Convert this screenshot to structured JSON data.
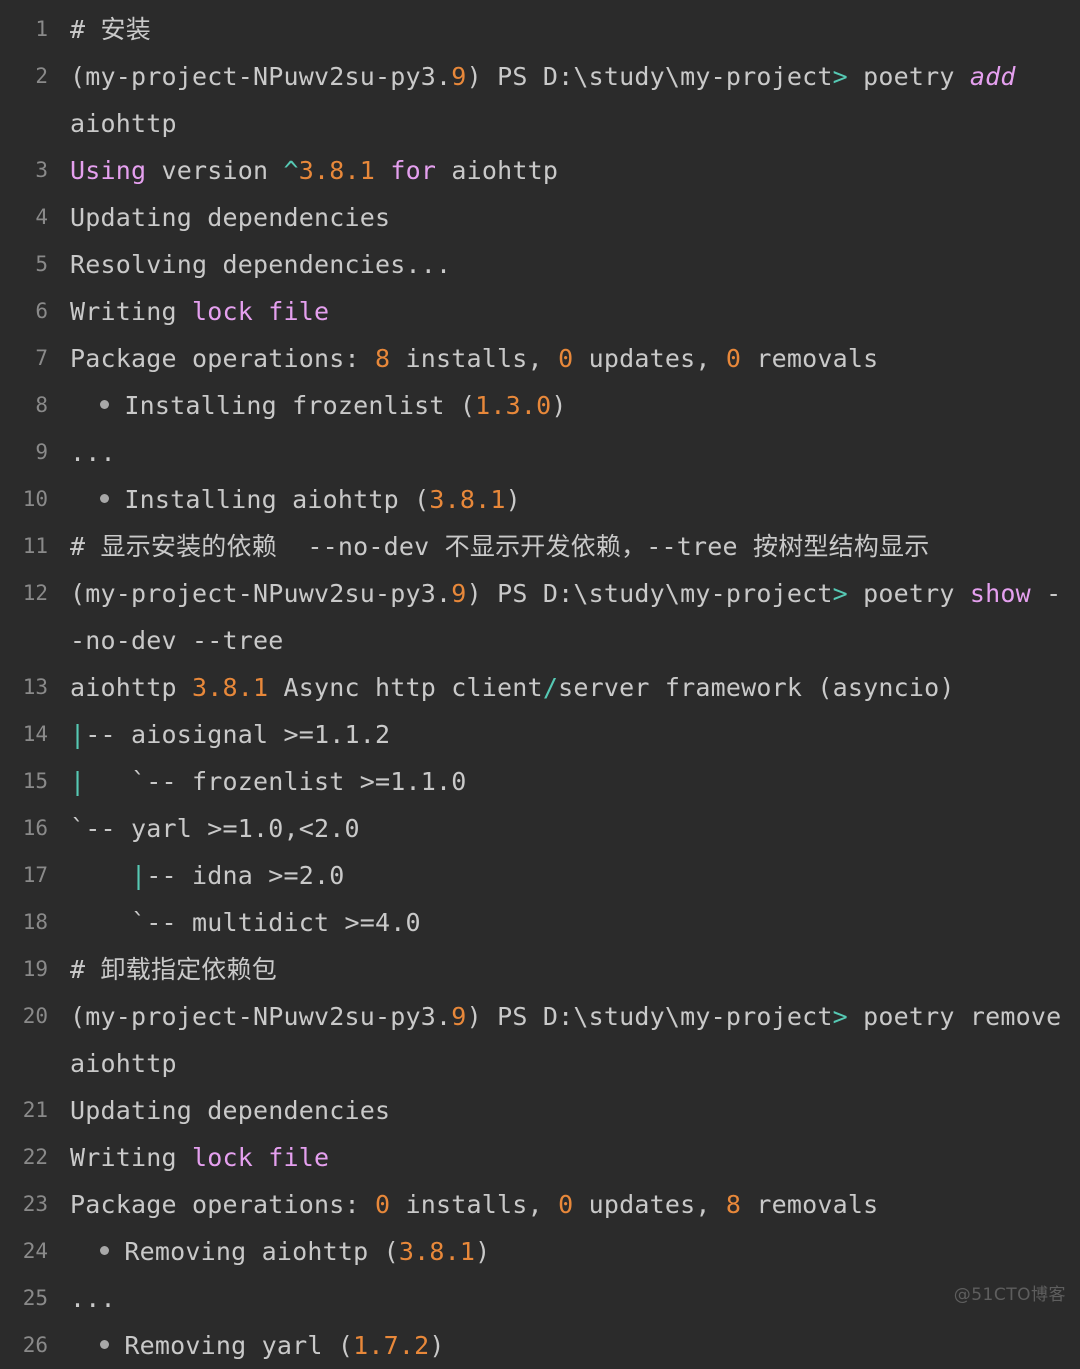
{
  "theme": {
    "background": "#2b2b2b",
    "text": "#c9c9c9",
    "gutter_text": "#8a8a8a",
    "keyword_pink": "#e5a0ef",
    "number_orange": "#e8883a",
    "symbol_teal": "#56c9b4",
    "bullet_gray": "#a8a8a8",
    "watermark": "#5e5e5e"
  },
  "watermark": {
    "text": "@51CTO博客"
  },
  "terminal": {
    "title": "poetry dependency management session",
    "prompt_venv": "(my-project-NPuwv2su-py3.9)",
    "prompt_shell": "PS",
    "prompt_path": "D:\\study\\my-project",
    "lines": [
      {
        "n": "1",
        "text": "# 安装"
      },
      {
        "n": "2",
        "text": "(my-project-NPuwv2su-py3.9) PS D:\\study\\my-project> poetry add aiohttp"
      },
      {
        "n": "3",
        "text": "Using version ^3.8.1 for aiohttp"
      },
      {
        "n": "4",
        "text": "Updating dependencies"
      },
      {
        "n": "5",
        "text": "Resolving dependencies..."
      },
      {
        "n": "6",
        "text": "Writing lock file"
      },
      {
        "n": "7",
        "text": "Package operations: 8 installs, 0 updates, 0 removals"
      },
      {
        "n": "8",
        "text": "  • Installing frozenlist (1.3.0)"
      },
      {
        "n": "9",
        "text": "  ..."
      },
      {
        "n": "10",
        "text": "  • Installing aiohttp (3.8.1)"
      },
      {
        "n": "11",
        "text": "# 显示安装的依赖  --no-dev 不显示开发依赖，--tree 按树型结构显示"
      },
      {
        "n": "12",
        "text": "(my-project-NPuwv2su-py3.9) PS D:\\study\\my-project> poetry show --no-dev --tree"
      },
      {
        "n": "13",
        "text": "aiohttp 3.8.1 Async http client/server framework (asyncio)"
      },
      {
        "n": "14",
        "text": "|-- aiosignal >=1.1.2"
      },
      {
        "n": "15",
        "text": "|   `-- frozenlist >=1.1.0"
      },
      {
        "n": "16",
        "text": "`-- yarl >=1.0,<2.0"
      },
      {
        "n": "17",
        "text": "    |-- idna >=2.0"
      },
      {
        "n": "18",
        "text": "    `-- multidict >=4.0"
      },
      {
        "n": "19",
        "text": "# 卸载指定依赖包"
      },
      {
        "n": "20",
        "text": "(my-project-NPuwv2su-py3.9) PS D:\\study\\my-project> poetry remove aiohttp"
      },
      {
        "n": "21",
        "text": "Updating dependencies"
      },
      {
        "n": "22",
        "text": "Writing lock file"
      },
      {
        "n": "23",
        "text": "Package operations: 0 installs, 0 updates, 8 removals"
      },
      {
        "n": "24",
        "text": "  • Removing aiohttp (3.8.1)"
      },
      {
        "n": "25",
        "text": "  ..."
      },
      {
        "n": "26",
        "text": "  • Removing yarl (1.7.2)"
      }
    ],
    "segments": {
      "l1": [
        {
          "t": "# 安装",
          "c": "plain"
        }
      ],
      "l2": [
        {
          "t": "(my-project-NPuwv2su-py3.",
          "c": "plain"
        },
        {
          "t": "9",
          "c": "orange"
        },
        {
          "t": ") PS D:\\study\\my-project",
          "c": "plain"
        },
        {
          "t": ">",
          "c": "teal"
        },
        {
          "t": " poetry ",
          "c": "plain"
        },
        {
          "t": "add",
          "c": "pink-i"
        },
        {
          "t": " aiohttp",
          "c": "plain"
        }
      ],
      "l3": [
        {
          "t": "Using",
          "c": "pink"
        },
        {
          "t": " version ",
          "c": "plain"
        },
        {
          "t": "^",
          "c": "teal"
        },
        {
          "t": "3.8.1",
          "c": "orange"
        },
        {
          "t": " ",
          "c": "plain"
        },
        {
          "t": "for",
          "c": "pink"
        },
        {
          "t": " aiohttp",
          "c": "plain"
        }
      ],
      "l4": [
        {
          "t": "Updating dependencies",
          "c": "plain"
        }
      ],
      "l5": [
        {
          "t": "Resolving dependencies...",
          "c": "plain"
        }
      ],
      "l6": [
        {
          "t": "Writing ",
          "c": "plain"
        },
        {
          "t": "lock file",
          "c": "pink"
        }
      ],
      "l7": [
        {
          "t": "Package operations: ",
          "c": "plain"
        },
        {
          "t": "8",
          "c": "orange"
        },
        {
          "t": " installs, ",
          "c": "plain"
        },
        {
          "t": "0",
          "c": "orange"
        },
        {
          "t": " updates, ",
          "c": "plain"
        },
        {
          "t": "0",
          "c": "orange"
        },
        {
          "t": " removals",
          "c": "plain"
        }
      ],
      "l8": [
        {
          "t": "BULLET",
          "c": "bullet"
        },
        {
          "t": " Installing frozenlist (",
          "c": "plain"
        },
        {
          "t": "1.3.0",
          "c": "orange"
        },
        {
          "t": ")",
          "c": "plain"
        }
      ],
      "l9": [
        {
          "t": "...",
          "c": "plain"
        }
      ],
      "l10": [
        {
          "t": "BULLET",
          "c": "bullet"
        },
        {
          "t": " Installing aiohttp (",
          "c": "plain"
        },
        {
          "t": "3.8.1",
          "c": "orange"
        },
        {
          "t": ")",
          "c": "plain"
        }
      ],
      "l11": [
        {
          "t": "# 显示安装的依赖  --no-dev 不显示开发依赖，--tree 按树型结构显示",
          "c": "plain"
        }
      ],
      "l12": [
        {
          "t": "(my-project-NPuwv2su-py3.",
          "c": "plain"
        },
        {
          "t": "9",
          "c": "orange"
        },
        {
          "t": ") PS D:\\study\\my-project",
          "c": "plain"
        },
        {
          "t": ">",
          "c": "teal"
        },
        {
          "t": " poetry ",
          "c": "plain"
        },
        {
          "t": "show",
          "c": "pink"
        },
        {
          "t": " --no-dev --tree",
          "c": "plain"
        }
      ],
      "l13": [
        {
          "t": "aiohttp ",
          "c": "plain"
        },
        {
          "t": "3.8.1",
          "c": "orange"
        },
        {
          "t": " Async http client",
          "c": "plain"
        },
        {
          "t": "/",
          "c": "teal"
        },
        {
          "t": "server framework (asyncio)",
          "c": "plain"
        }
      ],
      "l14": [
        {
          "t": "|",
          "c": "teal"
        },
        {
          "t": "-- aiosignal >=1.1.2",
          "c": "plain"
        }
      ],
      "l15": [
        {
          "t": "|",
          "c": "teal"
        },
        {
          "t": "   `-- frozenlist >=1.1.0",
          "c": "plain"
        }
      ],
      "l16": [
        {
          "t": "`-- yarl >=1.0,<2.0",
          "c": "plain"
        }
      ],
      "l17": [
        {
          "t": "    ",
          "c": "plain"
        },
        {
          "t": "|",
          "c": "teal"
        },
        {
          "t": "-- idna >=2.0",
          "c": "plain"
        }
      ],
      "l18": [
        {
          "t": "    `-- multidict >=4.0",
          "c": "plain"
        }
      ],
      "l19": [
        {
          "t": "# 卸载指定依赖包",
          "c": "plain"
        }
      ],
      "l20": [
        {
          "t": "(my-project-NPuwv2su-py3.",
          "c": "plain"
        },
        {
          "t": "9",
          "c": "orange"
        },
        {
          "t": ") PS D:\\study\\my-project",
          "c": "plain"
        },
        {
          "t": ">",
          "c": "teal"
        },
        {
          "t": " poetry remove aiohttp",
          "c": "plain"
        }
      ],
      "l21": [
        {
          "t": "Updating dependencies",
          "c": "plain"
        }
      ],
      "l22": [
        {
          "t": "Writing ",
          "c": "plain"
        },
        {
          "t": "lock file",
          "c": "pink"
        }
      ],
      "l23": [
        {
          "t": "Package operations: ",
          "c": "plain"
        },
        {
          "t": "0",
          "c": "orange"
        },
        {
          "t": " installs, ",
          "c": "plain"
        },
        {
          "t": "0",
          "c": "orange"
        },
        {
          "t": " updates, ",
          "c": "plain"
        },
        {
          "t": "8",
          "c": "orange"
        },
        {
          "t": " removals",
          "c": "plain"
        }
      ],
      "l24": [
        {
          "t": "BULLET",
          "c": "bullet"
        },
        {
          "t": " Removing aiohttp (",
          "c": "plain"
        },
        {
          "t": "3.8.1",
          "c": "orange"
        },
        {
          "t": ")",
          "c": "plain"
        }
      ],
      "l25": [
        {
          "t": "...",
          "c": "plain"
        }
      ],
      "l26": [
        {
          "t": "BULLET",
          "c": "bullet"
        },
        {
          "t": " Removing yarl (",
          "c": "plain"
        },
        {
          "t": "1.7.2",
          "c": "orange"
        },
        {
          "t": ")",
          "c": "plain"
        }
      ]
    }
  }
}
